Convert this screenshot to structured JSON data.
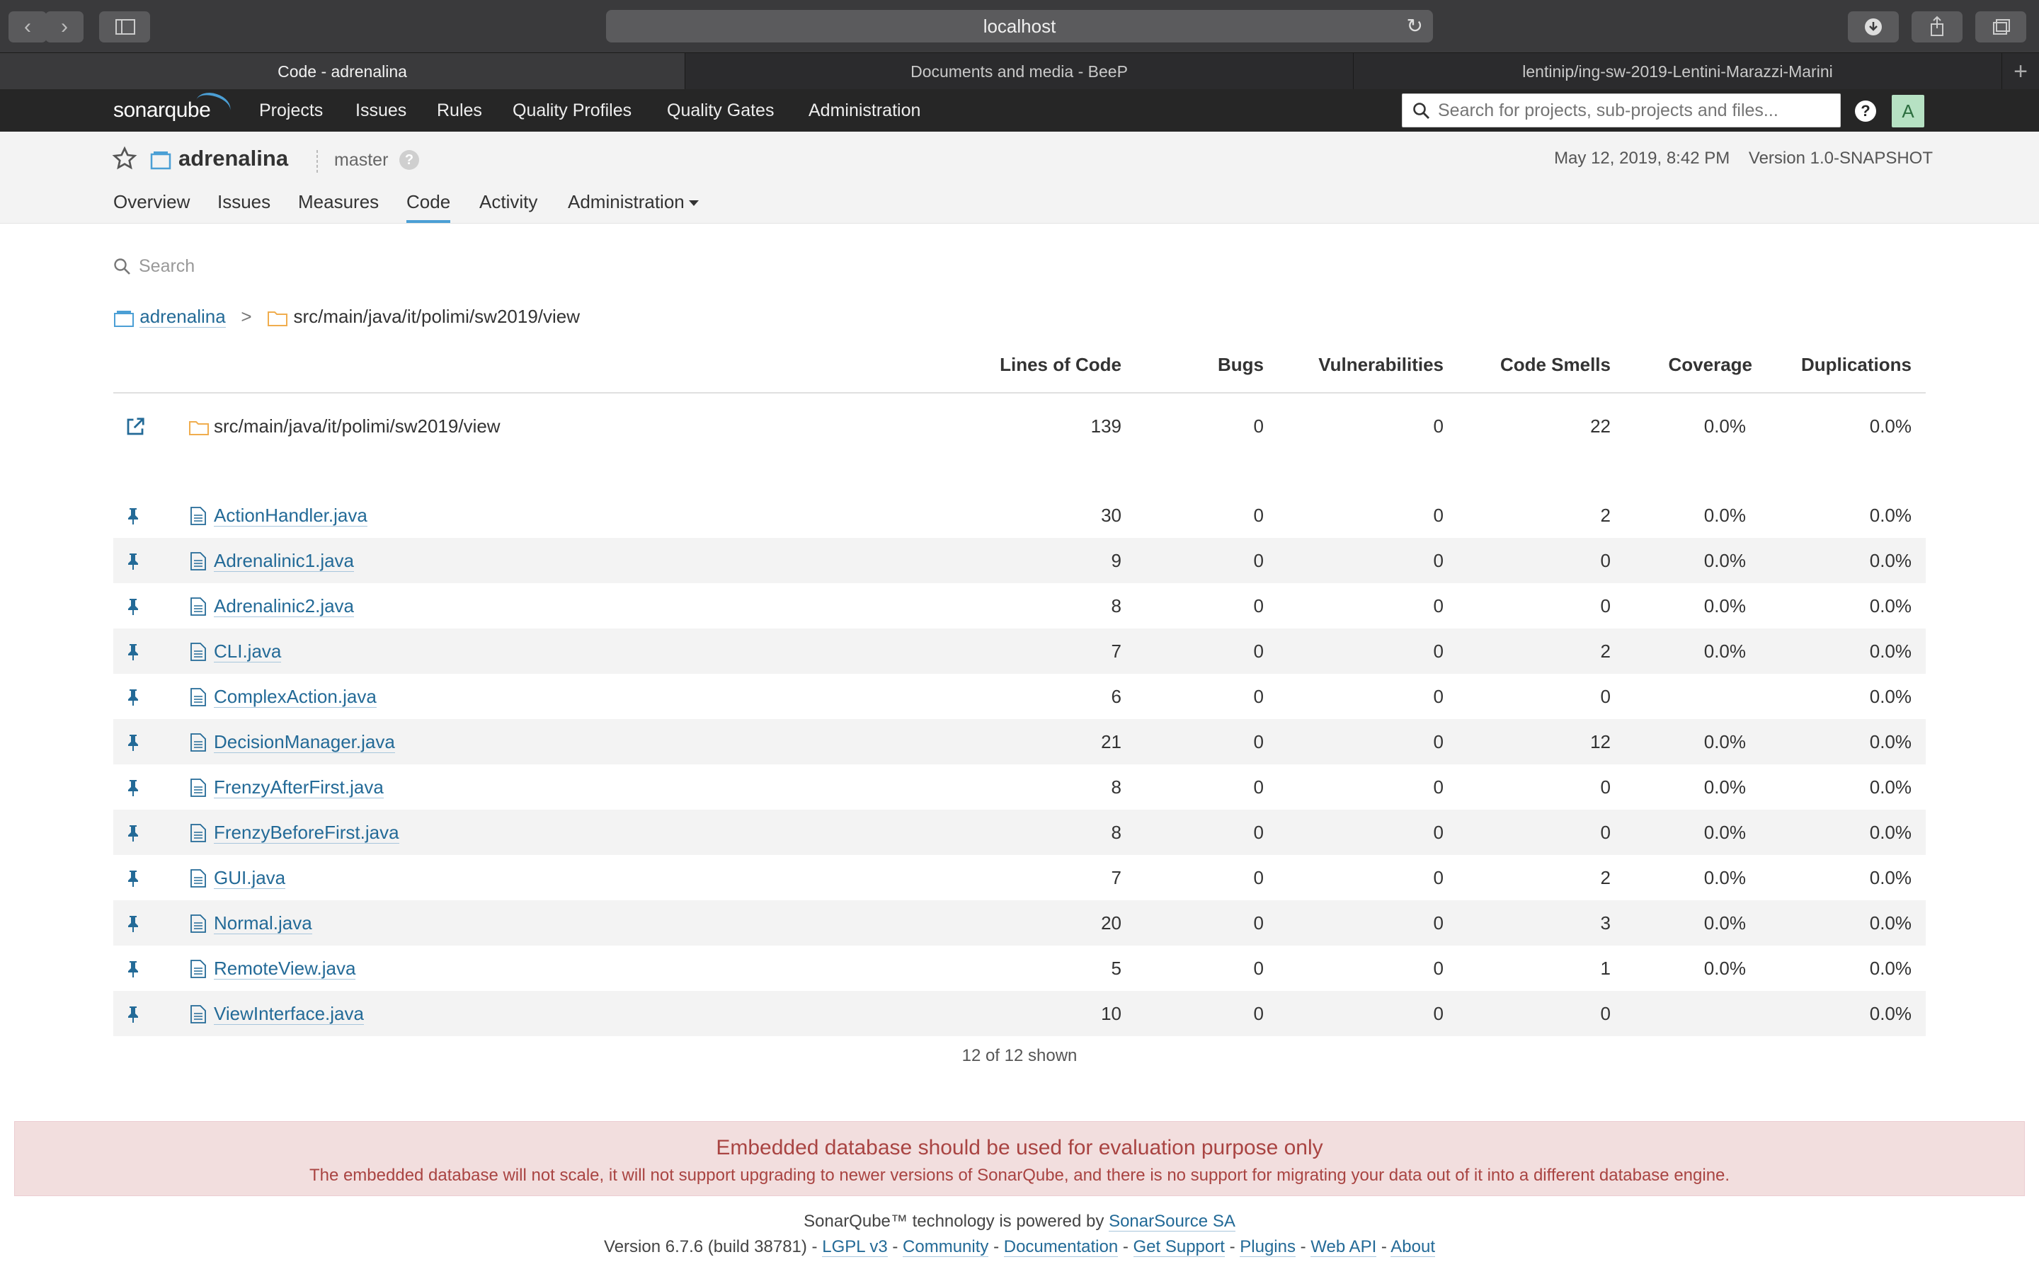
{
  "browser": {
    "url": "localhost",
    "tabs": [
      {
        "label": "Code - adrenalina"
      },
      {
        "label": "Documents and media - BeeP"
      },
      {
        "label": "lentinip/ing-sw-2019-Lentini-Marazzi-Marini"
      }
    ]
  },
  "sonar_nav": {
    "logo": "sonarqube",
    "menu": [
      "Projects",
      "Issues",
      "Rules",
      "Quality Profiles",
      "Quality Gates",
      "Administration"
    ],
    "search_placeholder": "Search for projects, sub-projects and files...",
    "help": "?",
    "avatar": "A"
  },
  "project": {
    "name": "adrenalina",
    "branch": "master",
    "branch_help": "?",
    "date": "May 12, 2019, 8:42 PM",
    "version": "Version 1.0-SNAPSHOT",
    "tabs": [
      "Overview",
      "Issues",
      "Measures",
      "Code",
      "Activity",
      "Administration"
    ],
    "active_tab": "Code"
  },
  "code": {
    "search_placeholder": "Search",
    "breadcrumb": {
      "root": "adrenalina",
      "sep": ">",
      "path": "src/main/java/it/polimi/sw2019/view"
    },
    "columns": [
      "Lines of Code",
      "Bugs",
      "Vulnerabilities",
      "Code Smells",
      "Coverage",
      "Duplications"
    ],
    "base": {
      "name": "src/main/java/it/polimi/sw2019/view",
      "loc": "139",
      "bugs": "0",
      "vulns": "0",
      "smells": "22",
      "coverage": "0.0%",
      "dup": "0.0%"
    },
    "files": [
      {
        "name": "ActionHandler.java",
        "loc": "30",
        "bugs": "0",
        "vulns": "0",
        "smells": "2",
        "coverage": "0.0%",
        "dup": "0.0%"
      },
      {
        "name": "Adrenalinic1.java",
        "loc": "9",
        "bugs": "0",
        "vulns": "0",
        "smells": "0",
        "coverage": "0.0%",
        "dup": "0.0%"
      },
      {
        "name": "Adrenalinic2.java",
        "loc": "8",
        "bugs": "0",
        "vulns": "0",
        "smells": "0",
        "coverage": "0.0%",
        "dup": "0.0%"
      },
      {
        "name": "CLI.java",
        "loc": "7",
        "bugs": "0",
        "vulns": "0",
        "smells": "2",
        "coverage": "0.0%",
        "dup": "0.0%"
      },
      {
        "name": "ComplexAction.java",
        "loc": "6",
        "bugs": "0",
        "vulns": "0",
        "smells": "0",
        "coverage": "",
        "dup": "0.0%"
      },
      {
        "name": "DecisionManager.java",
        "loc": "21",
        "bugs": "0",
        "vulns": "0",
        "smells": "12",
        "coverage": "0.0%",
        "dup": "0.0%"
      },
      {
        "name": "FrenzyAfterFirst.java",
        "loc": "8",
        "bugs": "0",
        "vulns": "0",
        "smells": "0",
        "coverage": "0.0%",
        "dup": "0.0%"
      },
      {
        "name": "FrenzyBeforeFirst.java",
        "loc": "8",
        "bugs": "0",
        "vulns": "0",
        "smells": "0",
        "coverage": "0.0%",
        "dup": "0.0%"
      },
      {
        "name": "GUI.java",
        "loc": "7",
        "bugs": "0",
        "vulns": "0",
        "smells": "2",
        "coverage": "0.0%",
        "dup": "0.0%"
      },
      {
        "name": "Normal.java",
        "loc": "20",
        "bugs": "0",
        "vulns": "0",
        "smells": "3",
        "coverage": "0.0%",
        "dup": "0.0%"
      },
      {
        "name": "RemoteView.java",
        "loc": "5",
        "bugs": "0",
        "vulns": "0",
        "smells": "1",
        "coverage": "0.0%",
        "dup": "0.0%"
      },
      {
        "name": "ViewInterface.java",
        "loc": "10",
        "bugs": "0",
        "vulns": "0",
        "smells": "0",
        "coverage": "",
        "dup": "0.0%"
      }
    ],
    "shown": "12 of 12 shown"
  },
  "warning": {
    "title": "Embedded database should be used for evaluation purpose only",
    "text": "The embedded database will not scale, it will not support upgrading to newer versions of SonarQube, and there is no support for migrating your data out of it into a different database engine."
  },
  "footer": {
    "powered_prefix": "SonarQube™ technology is powered by ",
    "powered_link": "SonarSource SA",
    "version": "Version 6.7.6 (build 38781)",
    "links": [
      "LGPL v3",
      "Community",
      "Documentation",
      "Get Support",
      "Plugins",
      "Web API",
      "About"
    ]
  },
  "colors": {
    "accent": "#4b9fd5",
    "link": "#236a97",
    "warning_bg": "#f2dede",
    "warning_text": "#a94442",
    "nav_bg": "#262626"
  }
}
